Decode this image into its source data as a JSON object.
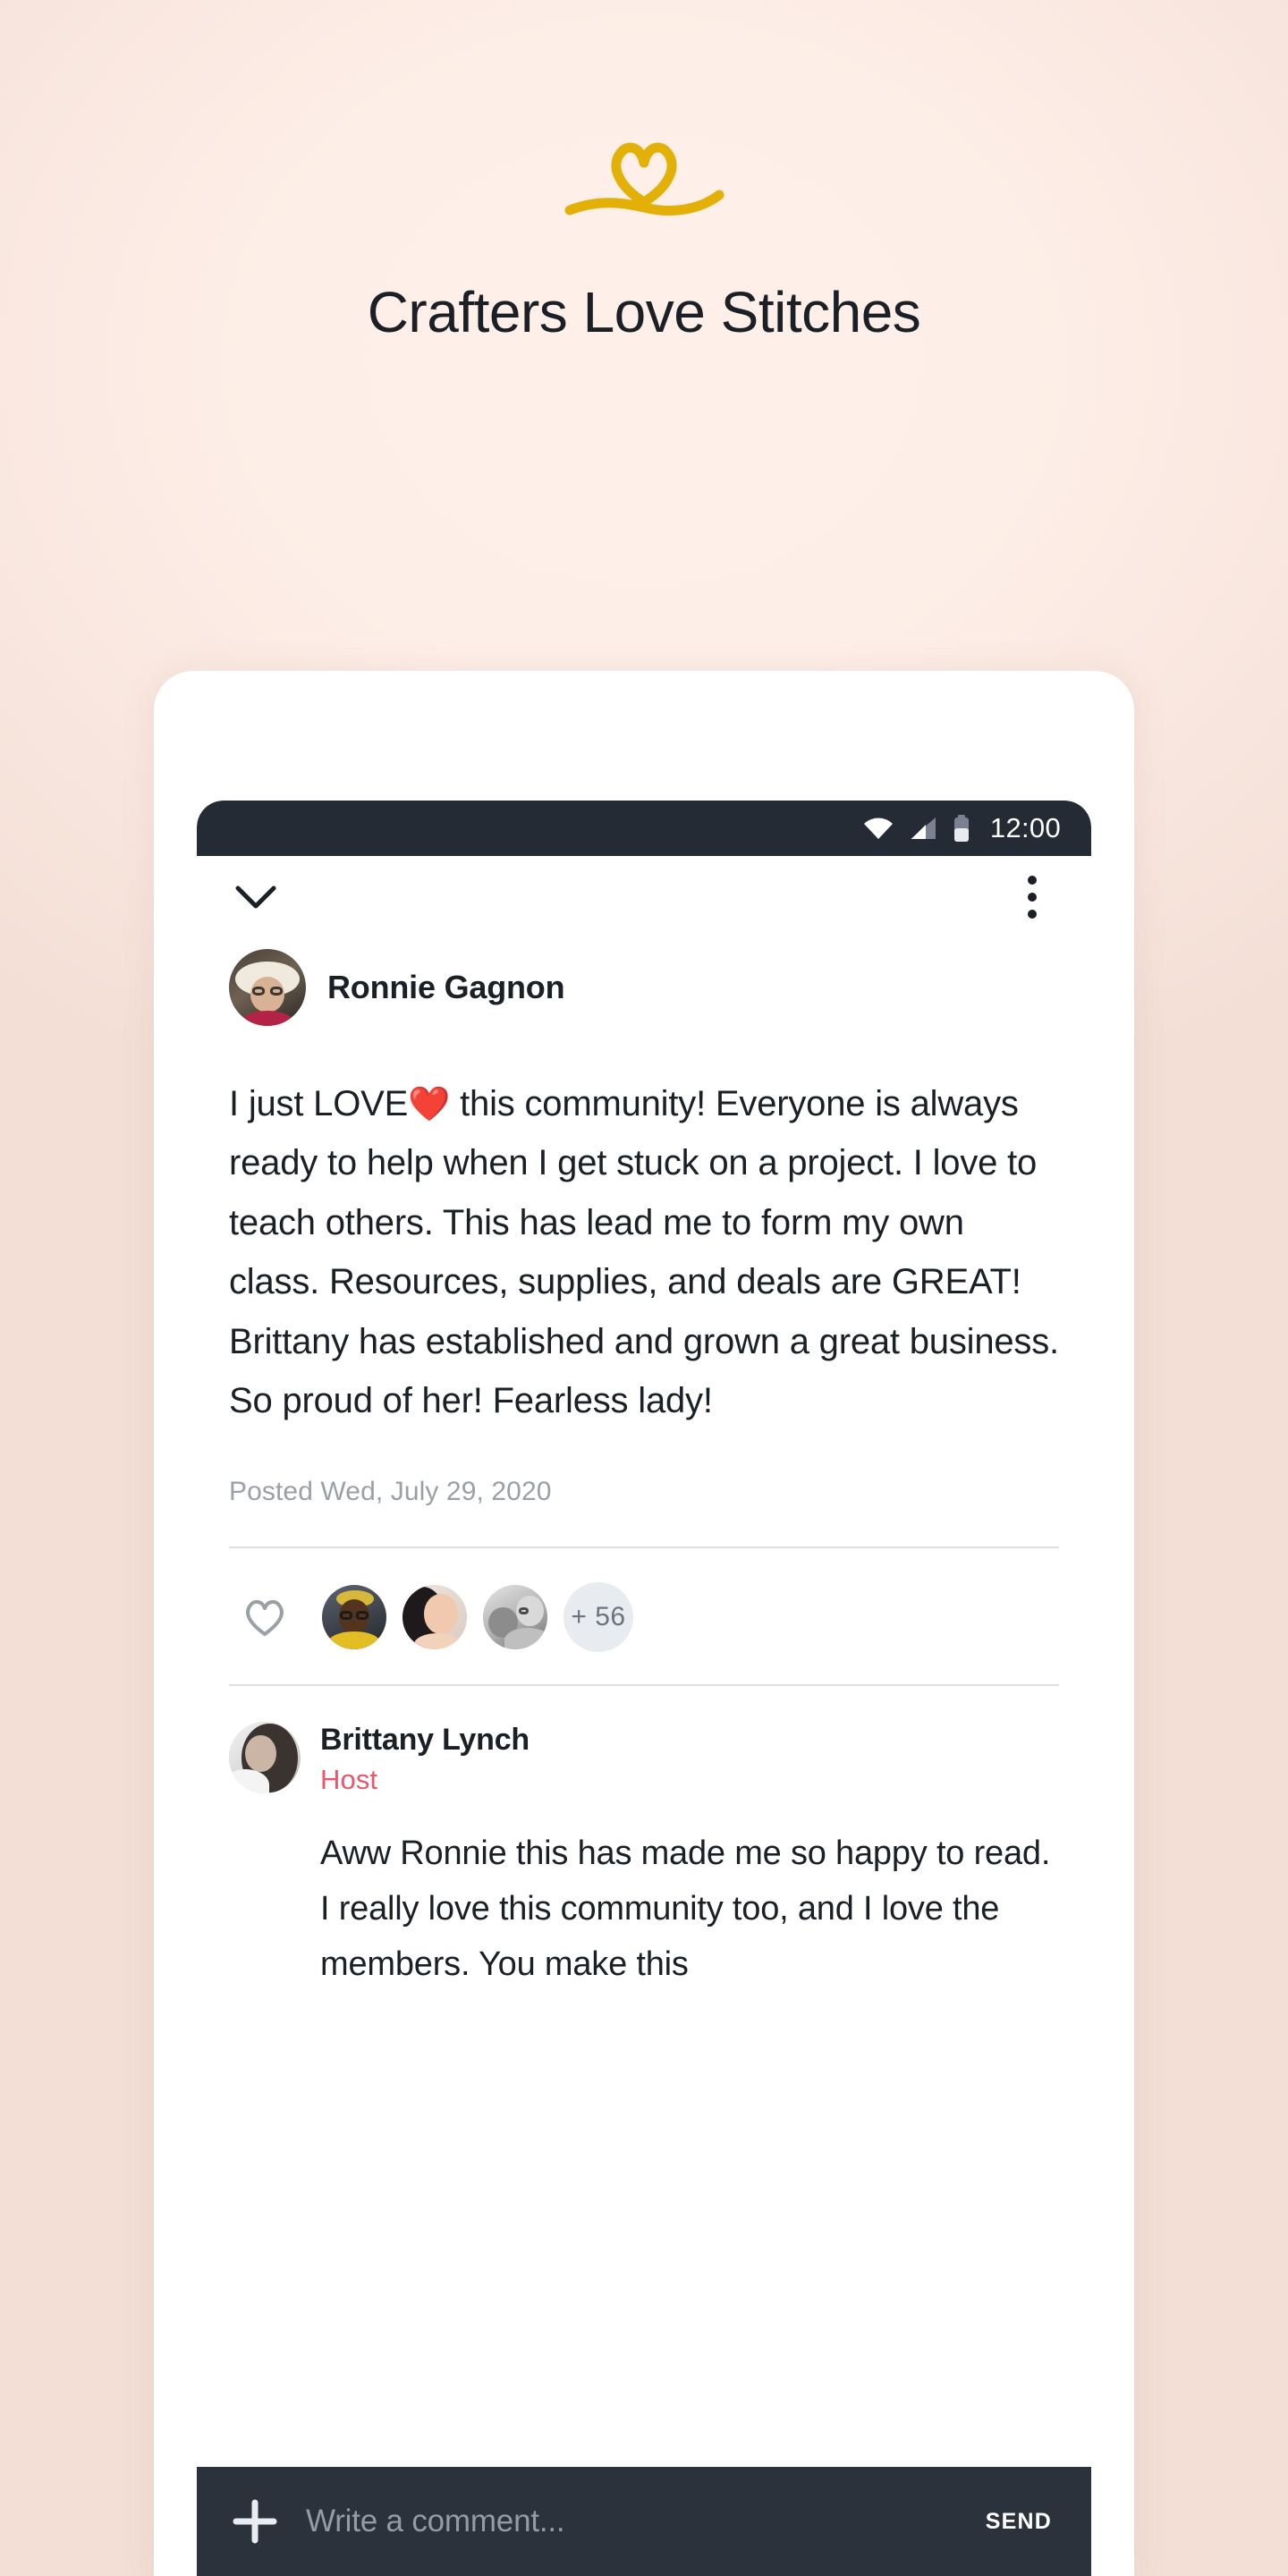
{
  "hero": {
    "logo_icon": "heart-swoosh-logo",
    "logo_color": "#E3B007",
    "title": "Crafters Love Stitches"
  },
  "phone": {
    "status_bar": {
      "wifi_icon": "wifi-icon",
      "signal_icon": "signal-bars-icon",
      "battery_icon": "battery-icon",
      "time": "12:00"
    },
    "nav": {
      "back_icon": "chevron-down-icon",
      "menu_icon": "overflow-menu-icon"
    },
    "post": {
      "author": "Ronnie Gagnon",
      "author_avatar": "avatar-ronnie-gagnon",
      "body_before_emoji": "I just LOVE",
      "emoji": "❤️",
      "body_after_emoji": " this community! Everyone is always ready to help when I get stuck on a project. I love to teach others. This has lead me to form my own class. Resources, supplies, and deals are GREAT! Brittany has established and grown a great business. So proud of her! Fearless lady!",
      "posted": "Posted Wed, July 29, 2020"
    },
    "reactions": {
      "like_icon": "heart-outline-icon",
      "avatars": [
        "reactor-avatar-1",
        "reactor-avatar-2",
        "reactor-avatar-3"
      ],
      "more_count": "+ 56"
    },
    "comment": {
      "author": "Brittany Lynch",
      "author_avatar": "avatar-brittany-lynch",
      "role": "Host",
      "role_color": "#E8576B",
      "body": "Aww Ronnie this has made me so happy to read. I really love this community too, and I love the members. You make this"
    },
    "composer": {
      "add_icon": "plus-icon",
      "placeholder": "Write a comment...",
      "value": "",
      "send_label": "SEND"
    }
  }
}
